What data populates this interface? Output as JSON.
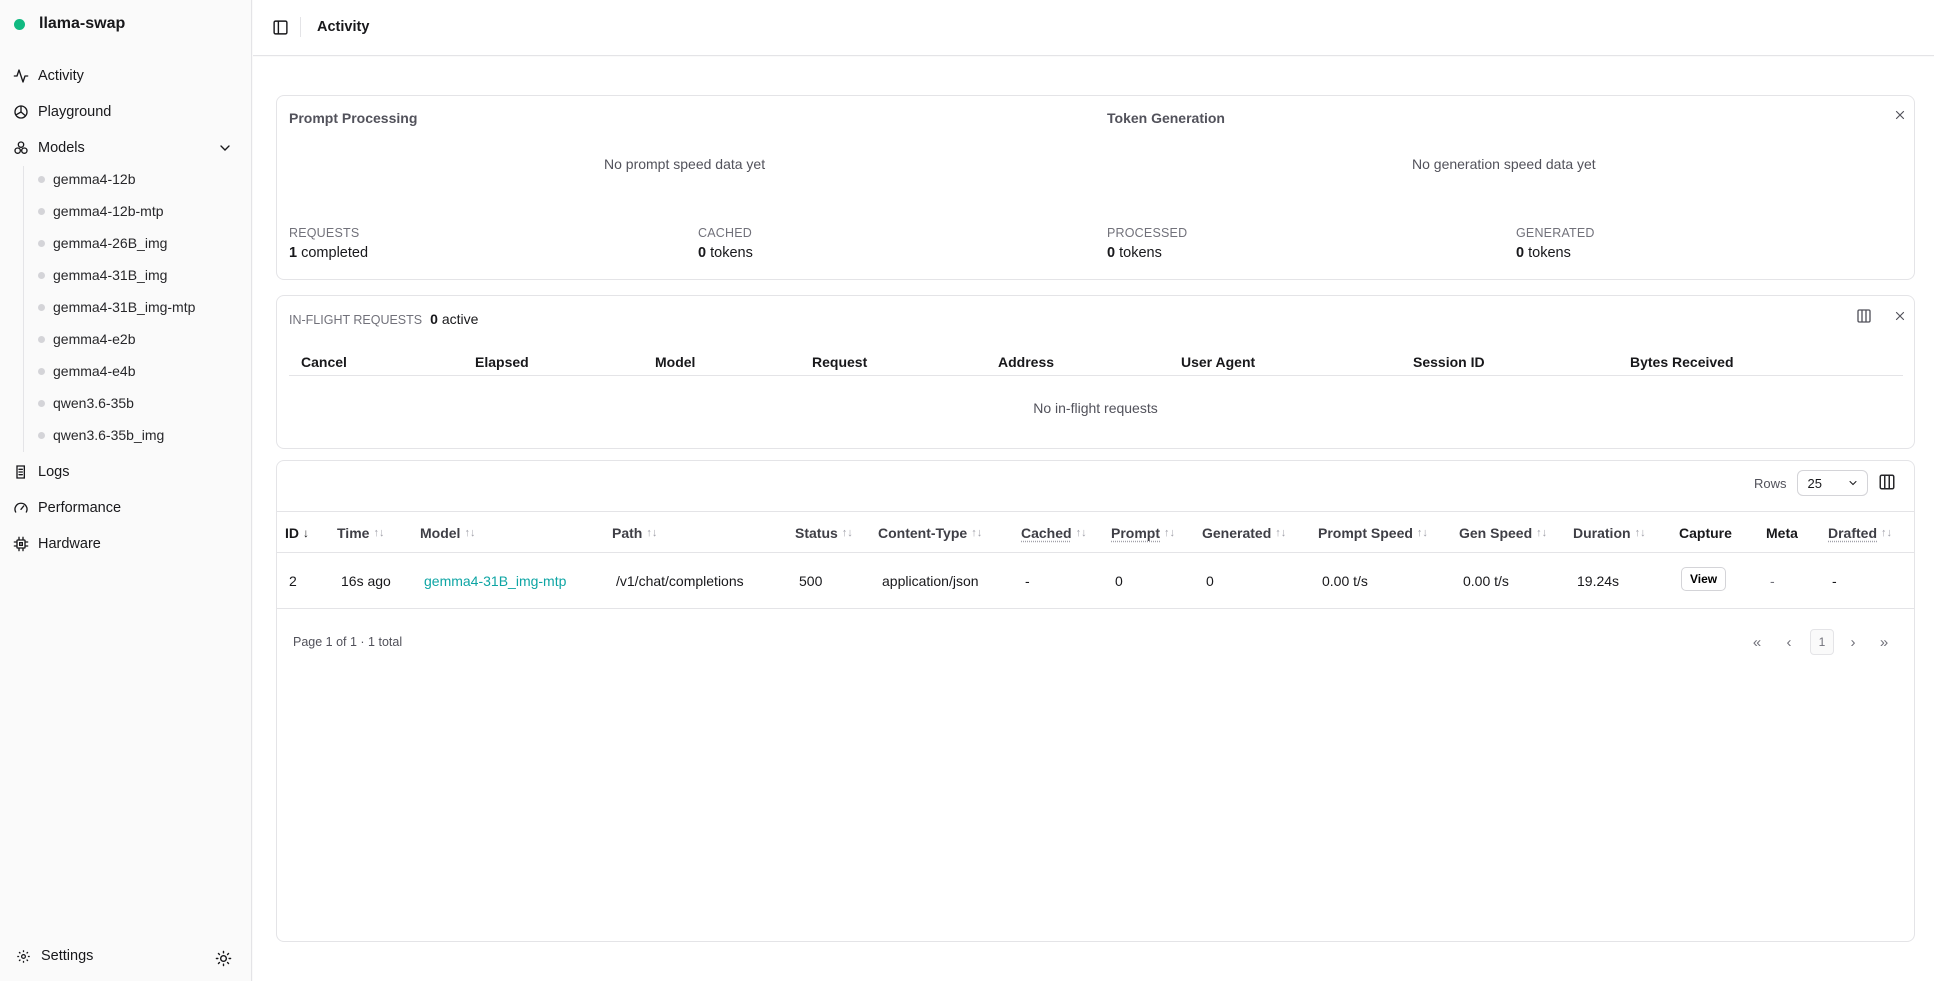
{
  "app": {
    "name": "llama-swap",
    "status_color": "#10b981"
  },
  "sidebar": {
    "items": [
      {
        "label": "Activity",
        "icon": "activity-icon"
      },
      {
        "label": "Playground",
        "icon": "playground-icon"
      },
      {
        "label": "Models",
        "icon": "models-icon"
      },
      {
        "label": "Logs",
        "icon": "logs-icon"
      },
      {
        "label": "Performance",
        "icon": "gauge-icon"
      },
      {
        "label": "Hardware",
        "icon": "cpu-icon"
      }
    ],
    "models": [
      "gemma4-12b",
      "gemma4-12b-mtp",
      "gemma4-26B_img",
      "gemma4-31B_img",
      "gemma4-31B_img-mtp",
      "gemma4-e2b",
      "gemma4-e4b",
      "qwen3.6-35b",
      "qwen3.6-35b_img"
    ],
    "settings_label": "Settings"
  },
  "header": {
    "title": "Activity"
  },
  "stats": {
    "prompt_title": "Prompt Processing",
    "prompt_empty": "No prompt speed data yet",
    "gen_title": "Token Generation",
    "gen_empty": "No generation speed data yet",
    "requests_label": "REQUESTS",
    "requests_value": "1",
    "requests_unit": "completed",
    "cached_label": "CACHED",
    "cached_value": "0",
    "cached_unit": "tokens",
    "processed_label": "PROCESSED",
    "processed_value": "0",
    "processed_unit": "tokens",
    "generated_label": "GENERATED",
    "generated_value": "0",
    "generated_unit": "tokens"
  },
  "inflight": {
    "label": "IN-FLIGHT REQUESTS",
    "count": "0",
    "count_unit": "active",
    "columns": [
      "Cancel",
      "Elapsed",
      "Model",
      "Request",
      "Address",
      "User Agent",
      "Session ID",
      "Bytes Received"
    ],
    "empty": "No in-flight requests"
  },
  "table": {
    "rows_label": "Rows",
    "rows_value": "25",
    "columns": {
      "id": "ID",
      "time": "Time",
      "model": "Model",
      "path": "Path",
      "status": "Status",
      "content_type": "Content-Type",
      "cached": "Cached",
      "prompt": "Prompt",
      "generated": "Generated",
      "prompt_speed": "Prompt Speed",
      "gen_speed": "Gen Speed",
      "duration": "Duration",
      "capture": "Capture",
      "meta": "Meta",
      "drafted": "Drafted"
    },
    "row": {
      "id": "2",
      "time": "16s ago",
      "model": "gemma4-31B_img-mtp",
      "path": "/v1/chat/completions",
      "status": "500",
      "content_type": "application/json",
      "cached": "-",
      "prompt": "0",
      "generated": "0",
      "prompt_speed": "0.00 t/s",
      "gen_speed": "0.00 t/s",
      "duration": "19.24s",
      "capture": "View",
      "meta": "-",
      "drafted": "-"
    },
    "page_info": "Page 1 of 1 · 1 total",
    "current_page": "1"
  }
}
